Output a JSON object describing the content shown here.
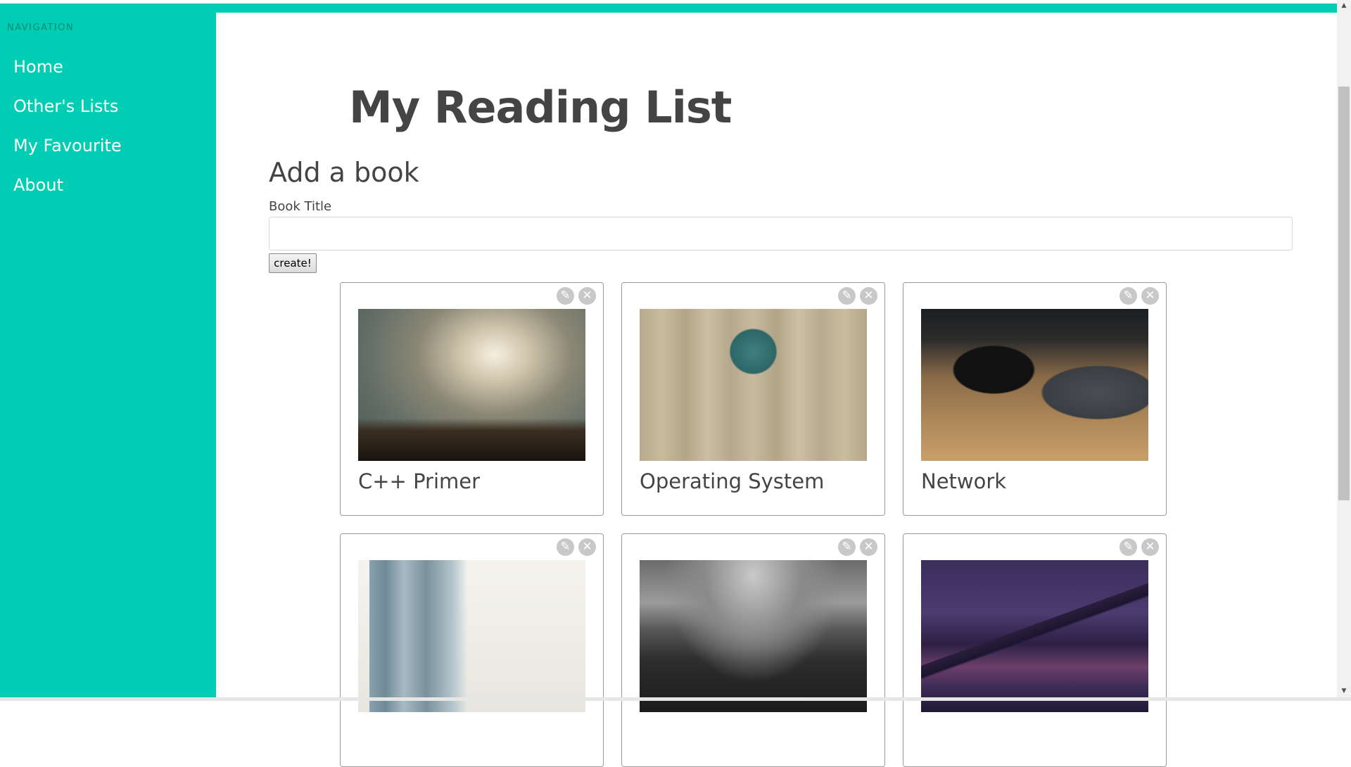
{
  "colors": {
    "accent": "#00cdb3",
    "text": "#444444"
  },
  "sidebar": {
    "heading": "NAVIGATION",
    "items": [
      {
        "label": "Home"
      },
      {
        "label": "Other's Lists"
      },
      {
        "label": "My Favourite"
      },
      {
        "label": "About"
      }
    ]
  },
  "main": {
    "title": "My Reading List",
    "add_section": {
      "heading": "Add a book",
      "field_label": "Book Title",
      "input_value": "",
      "button_label": "create!"
    },
    "cards": [
      {
        "title": "C++ Primer",
        "image": "cloudy-sky-mountain"
      },
      {
        "title": "Operating System",
        "image": "typewriter-desk"
      },
      {
        "title": "Network",
        "image": "man-with-laptop"
      },
      {
        "title": "",
        "image": "palm-tree-building"
      },
      {
        "title": "",
        "image": "rocky-shore"
      },
      {
        "title": "",
        "image": "night-bridge-city"
      }
    ],
    "card_actions": {
      "edit_icon": "pencil-icon",
      "delete_icon": "close-icon"
    }
  }
}
